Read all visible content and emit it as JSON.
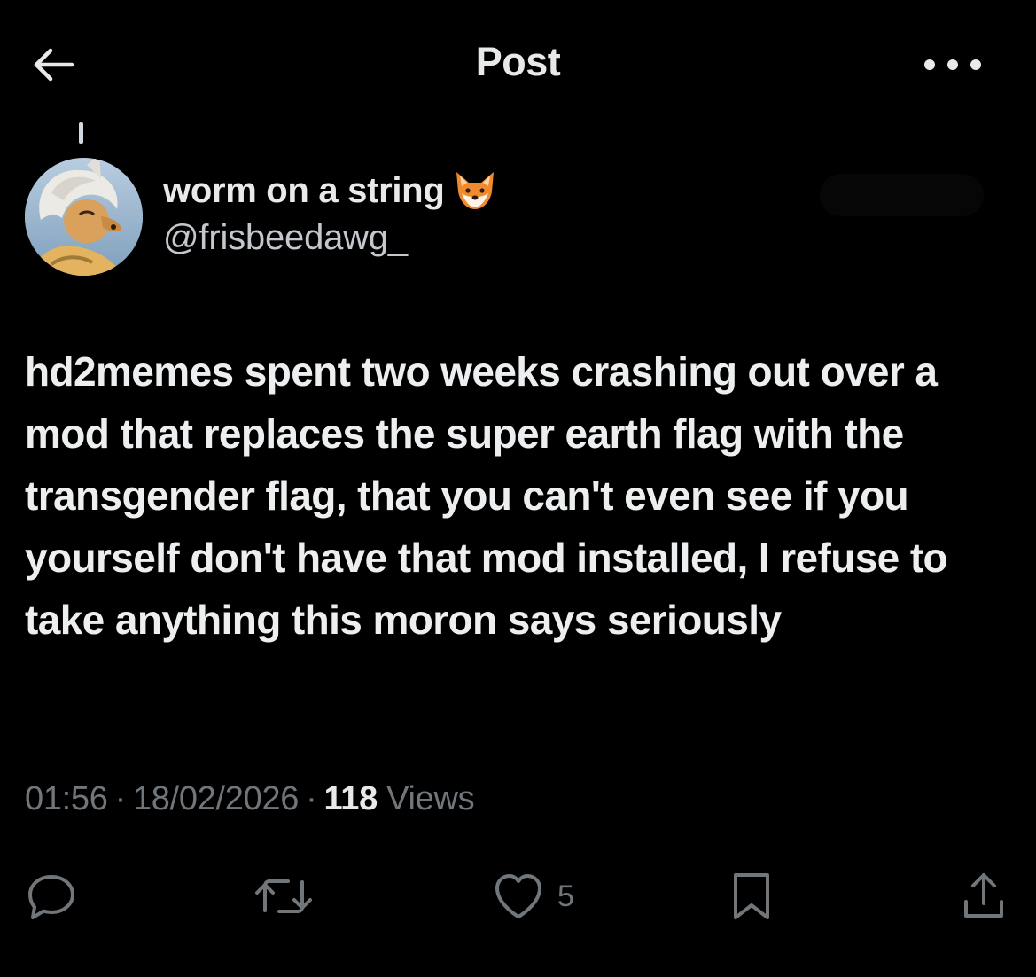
{
  "header": {
    "title": "Post",
    "back_icon": "arrow-left-icon",
    "more_icon": "more-horizontal-icon"
  },
  "author": {
    "display_name": "worm on a string",
    "name_emoji": "🦊",
    "handle": "@frisbeedawg_"
  },
  "post": {
    "text": "hd2memes spent two weeks crashing out over a mod that replaces the super earth flag with the transgender flag, that you can't even see if you yourself don't have that mod installed, I refuse to take anything this moron says seriously",
    "time": "01:56",
    "date": "18/02/2026",
    "views_count": "118",
    "views_label": "Views",
    "separator": "·"
  },
  "actions": {
    "reply_icon": "reply-icon",
    "repost_icon": "repost-icon",
    "like_icon": "heart-icon",
    "like_count": "5",
    "bookmark_icon": "bookmark-icon",
    "share_icon": "share-icon"
  },
  "colors": {
    "background": "#000000",
    "text_primary": "#e7e9ea",
    "text_secondary": "#71767b"
  }
}
